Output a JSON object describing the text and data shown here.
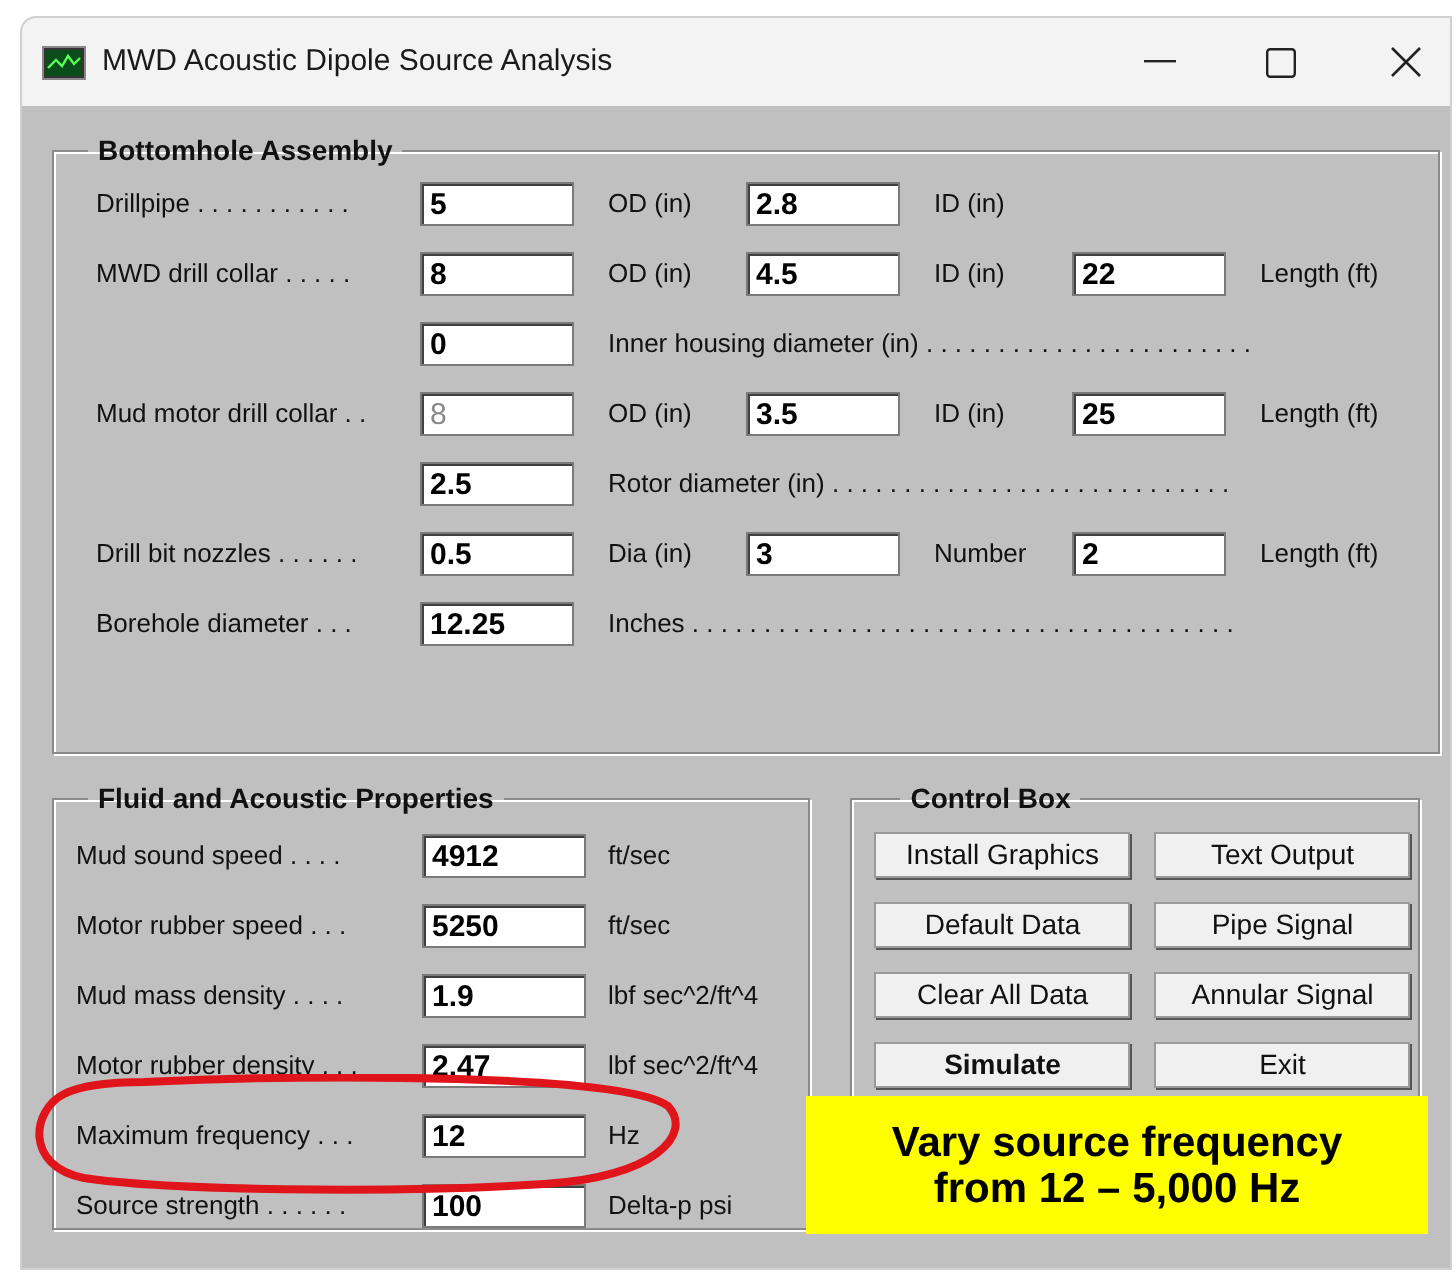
{
  "window": {
    "title": "MWD Acoustic Dipole Source Analysis"
  },
  "bottomhole_assembly": {
    "title": "Bottomhole Assembly",
    "rows": [
      {
        "label": "Drillpipe . . . . . . . . . . .",
        "cells": [
          {
            "value": "5",
            "disabled": false,
            "unit": "OD (in)"
          },
          {
            "value": "2.8",
            "disabled": false,
            "unit": "ID (in)"
          }
        ]
      },
      {
        "label": "MWD drill collar . . . . .",
        "cells": [
          {
            "value": "8",
            "disabled": false,
            "unit": "OD (in)"
          },
          {
            "value": "4.5",
            "disabled": false,
            "unit": "ID (in)"
          },
          {
            "value": "22",
            "disabled": false,
            "unit": "Length (ft)"
          }
        ]
      },
      {
        "cells": [
          {
            "value": "0",
            "disabled": false,
            "unit": "Inner housing diameter (in) . . . . . . . . . . . . . . . . . . . . . . ."
          }
        ]
      },
      {
        "label": "Mud motor drill collar . .",
        "cells": [
          {
            "value": "8",
            "disabled": true,
            "unit": "OD (in)"
          },
          {
            "value": "3.5",
            "disabled": false,
            "unit": "ID (in)"
          },
          {
            "value": "25",
            "disabled": false,
            "unit": "Length (ft)"
          }
        ]
      },
      {
        "cells": [
          {
            "value": "2.5",
            "disabled": false,
            "unit": "Rotor diameter (in) . . . . . . . . . . . . . . . . . . . . . . . . . . . ."
          }
        ]
      },
      {
        "label": "Drill bit nozzles . . . . . .",
        "cells": [
          {
            "value": "0.5",
            "disabled": false,
            "unit": "Dia (in)"
          },
          {
            "value": "3",
            "disabled": false,
            "unit": "Number"
          },
          {
            "value": "2",
            "disabled": false,
            "unit": "Length (ft)"
          }
        ]
      },
      {
        "label": "Borehole diameter  . . .",
        "cells": [
          {
            "value": "12.25",
            "disabled": false,
            "unit": "Inches . . . . . . . . . . . . . . . . . . . . . . . . . . . . . . . . . . . . . ."
          }
        ]
      }
    ]
  },
  "fluid_properties": {
    "title": "Fluid and Acoustic Properties",
    "rows": [
      {
        "label": "Mud sound speed . . . .",
        "value": "4912",
        "unit": "ft/sec",
        "highlighted": false
      },
      {
        "label": "Motor rubber speed . . .",
        "value": "5250",
        "unit": "ft/sec",
        "highlighted": false
      },
      {
        "label": "Mud mass density  . . . .",
        "value": "1.9",
        "unit": "lbf sec^2/ft^4",
        "highlighted": false
      },
      {
        "label": "Motor rubber density . . .",
        "value": "2.47",
        "unit": "lbf sec^2/ft^4",
        "highlighted": false
      },
      {
        "label": "Maximum frequency  . . .",
        "value": "12",
        "unit": "Hz",
        "highlighted": true
      },
      {
        "label": "Source strength  . . . . . .",
        "value": "100",
        "unit": "Delta-p psi",
        "highlighted": false
      }
    ]
  },
  "control_box": {
    "title": "Control Box",
    "buttons": [
      {
        "label": "Install Graphics",
        "default": false
      },
      {
        "label": "Text Output",
        "default": false
      },
      {
        "label": "Default Data",
        "default": false
      },
      {
        "label": "Pipe Signal",
        "default": false
      },
      {
        "label": "Clear All Data",
        "default": false
      },
      {
        "label": "Annular Signal",
        "default": false
      },
      {
        "label": "Simulate",
        "default": true
      },
      {
        "label": "Exit",
        "default": false
      }
    ]
  },
  "annotation": {
    "callout_lines": [
      "Vary source frequency",
      "from 12 – 5,000 Hz"
    ]
  }
}
